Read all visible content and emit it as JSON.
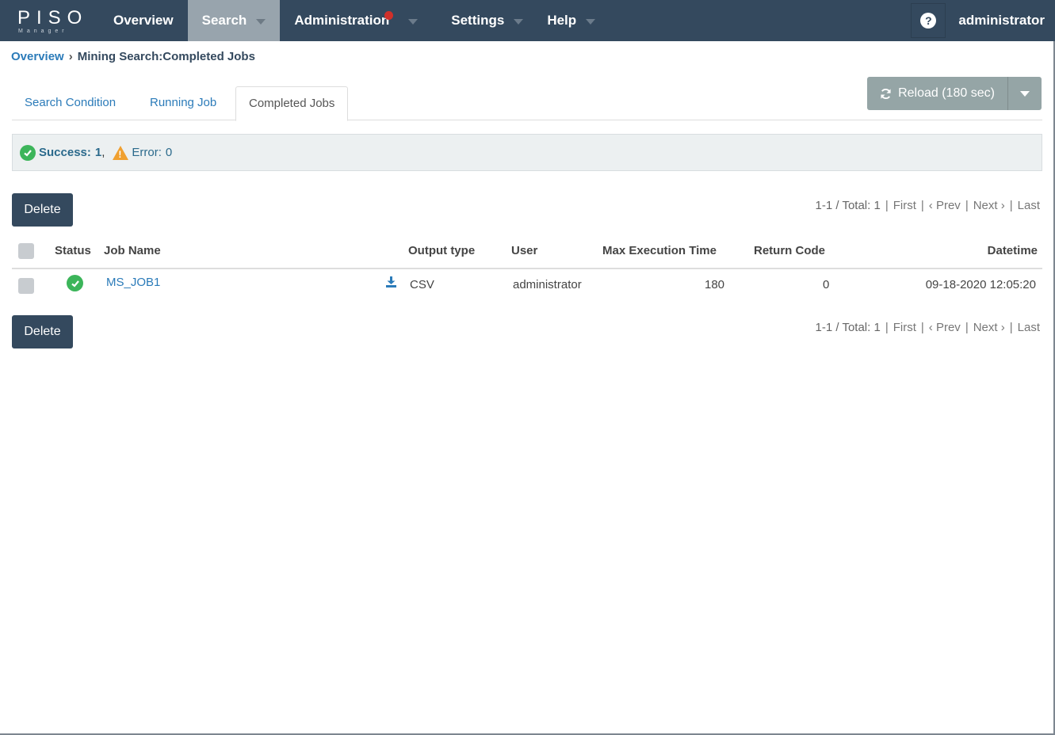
{
  "app": {
    "logo_text": "PISO",
    "logo_sub": "Manager"
  },
  "nav": {
    "items": [
      {
        "label": "Overview"
      },
      {
        "label": "Search"
      },
      {
        "label": "Administration"
      },
      {
        "label": "Settings"
      },
      {
        "label": "Help"
      }
    ],
    "help_icon": "?",
    "user": "administrator"
  },
  "breadcrumb": {
    "root": "Overview",
    "separator": "›",
    "current": "Mining Search:Completed Jobs"
  },
  "tabs": [
    {
      "label": "Search Condition"
    },
    {
      "label": "Running Job"
    },
    {
      "label": "Completed Jobs"
    }
  ],
  "reload": {
    "label": "Reload (180 sec)",
    "icon": "refresh-icon"
  },
  "status": {
    "success_label": "Success:",
    "success_count": "1",
    "comma": ",",
    "error_label": "Error:",
    "error_count": "0"
  },
  "actions": {
    "delete_label": "Delete"
  },
  "pager": {
    "range": "1-1 / Total: 1",
    "sep": "|",
    "first": "First",
    "prev": "‹ Prev",
    "next": "Next ›",
    "last": "Last"
  },
  "table": {
    "headers": {
      "status": "Status",
      "job_name": "Job Name",
      "output_type": "Output type",
      "user": "User",
      "max_exec": "Max Execution Time",
      "return_code": "Return Code",
      "datetime": "Datetime"
    },
    "rows": [
      {
        "job_name": "MS_JOB1",
        "output_type": "CSV",
        "user": "administrator",
        "max_exec": "180",
        "return_code": "0",
        "datetime": "09-18-2020 12:05:20"
      }
    ]
  },
  "colors": {
    "navbar": "#34495e",
    "active_nav": "#98a4ad",
    "link": "#2b7bb9",
    "success": "#3cb55a",
    "warning": "#f0a030",
    "alert_dot": "#d0302a"
  }
}
